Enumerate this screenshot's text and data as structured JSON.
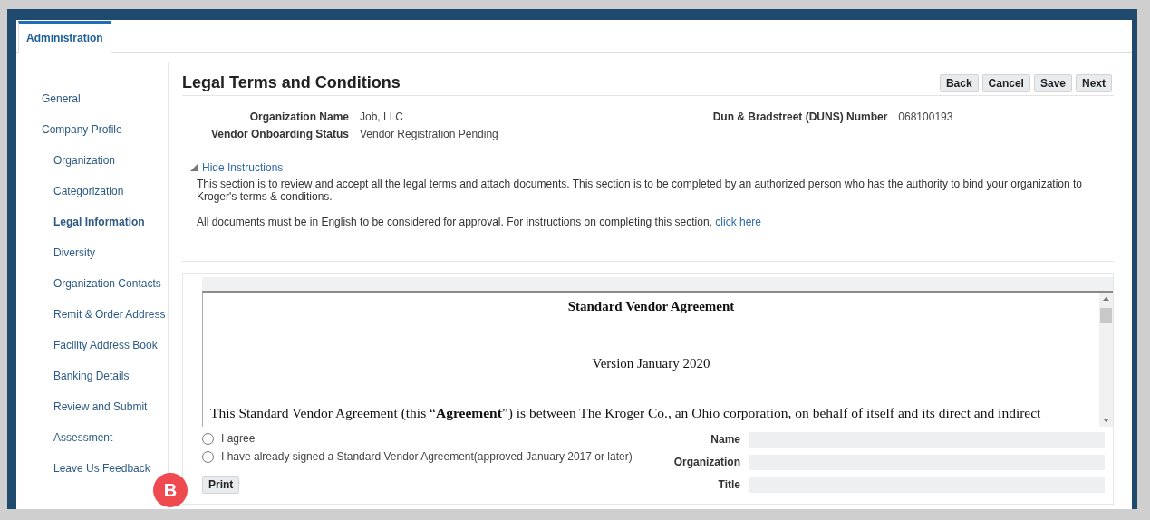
{
  "tab": {
    "label": "Administration",
    "selected": true
  },
  "sidebar": {
    "items": [
      {
        "label": "General",
        "selected": false
      },
      {
        "label": "Company Profile",
        "selected": false,
        "children": [
          {
            "label": "Organization",
            "selected": false
          },
          {
            "label": "Categorization",
            "selected": false
          },
          {
            "label": "Legal Information",
            "selected": true
          },
          {
            "label": "Diversity",
            "selected": false
          },
          {
            "label": "Organization Contacts",
            "selected": false
          },
          {
            "label": "Remit & Order Address",
            "selected": false
          },
          {
            "label": "Facility Address Book",
            "selected": false
          },
          {
            "label": "Banking Details",
            "selected": false
          },
          {
            "label": "Review and Submit",
            "selected": false
          },
          {
            "label": "Assessment",
            "selected": false
          },
          {
            "label": "Leave Us Feedback",
            "selected": false
          }
        ]
      }
    ]
  },
  "page": {
    "title": "Legal Terms and Conditions",
    "buttons": [
      "Back",
      "Cancel",
      "Save",
      "Next"
    ]
  },
  "info": [
    {
      "label": "Organization Name",
      "value": "Job, LLC"
    },
    {
      "label": "Dun & Bradstreet (DUNS) Number",
      "value": "068100193"
    },
    {
      "label": "Vendor Onboarding Status",
      "value": "Vendor Registration Pending"
    }
  ],
  "instructions": {
    "toggle": "Hide Instructions",
    "expanded": true,
    "paragraph_1": "This section is to review and accept all the legal terms and attach documents. This section is to be completed by an authorized person who has the authority to bind your organization to Kroger's terms & conditions.",
    "paragraph_2": "All documents must be in English to be considered for approval. For instructions on completing this section,",
    "link": "click here"
  },
  "agreement": {
    "title": "Standard Vendor Agreement",
    "version": "Version January 2020",
    "body": "This Standard Vendor Agreement (this “**Agreement**”) is between The Kroger Co., an Ohio corporation, on behalf of itself and its direct and indirect"
  },
  "options": [
    {
      "label": "I agree",
      "selected": false
    },
    {
      "label": "I have already signed a Standard Vendor Agreement(approved January 2017 or later)",
      "selected": false
    }
  ],
  "fields": [
    {
      "label": "Name"
    },
    {
      "label": "Organization"
    },
    {
      "label": "Title"
    }
  ],
  "print_button": "Print",
  "badge": "B"
}
